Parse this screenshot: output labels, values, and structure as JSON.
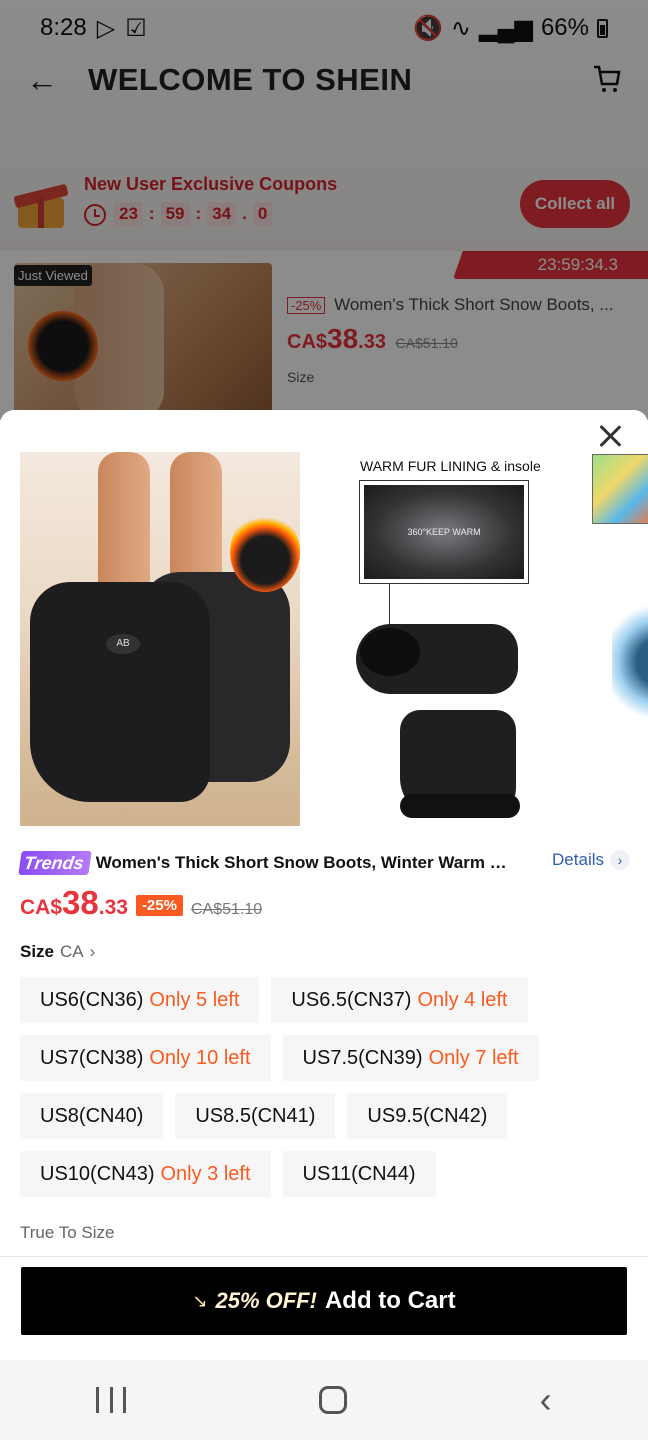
{
  "status_bar": {
    "time": "8:28",
    "battery": "66%"
  },
  "header": {
    "title": "WELCOME TO SHEIN"
  },
  "coupon_banner": {
    "title": "New User Exclusive Coupons",
    "countdown": {
      "hours": "23",
      "minutes": "59",
      "seconds": "34",
      "tenths": "0"
    },
    "collect_label": "Collect all"
  },
  "background_product": {
    "badge": "Just Viewed",
    "timer": "23:59:34.3",
    "discount": "-25%",
    "name": "Women's Thick Short Snow Boots, ...",
    "currency": "CA$",
    "price_int": "38",
    "price_dec": ".33",
    "original_price": "CA$51.10",
    "size_label": "Size"
  },
  "gallery": {
    "boot_logo": "AB",
    "fur_caption": "WARM FUR LINING & insole",
    "keep_warm": "360°KEEP WARM"
  },
  "product": {
    "trend_badge": "Trends",
    "title": "Women's Thick Short Snow Boots, Winter Warm Pl...",
    "details_label": "Details",
    "currency": "CA$",
    "price_int": "38",
    "price_dec": ".33",
    "discount": "-25%",
    "original_price": "CA$51.10"
  },
  "size_section": {
    "label": "Size",
    "unit": "CA",
    "rows": [
      [
        {
          "size": "US6(CN36)",
          "stock": "Only 5 left"
        },
        {
          "size": "US6.5(CN37)",
          "stock": "Only 4 left"
        }
      ],
      [
        {
          "size": "US7(CN38)",
          "stock": "Only 10 left"
        },
        {
          "size": "US7.5(CN39)",
          "stock": "Only 7 left"
        }
      ],
      [
        {
          "size": "US8(CN40)",
          "stock": ""
        },
        {
          "size": "US8.5(CN41)",
          "stock": ""
        },
        {
          "size": "US9.5(CN42)",
          "stock": ""
        }
      ],
      [
        {
          "size": "US10(CN43)",
          "stock": "Only 3 left"
        },
        {
          "size": "US11(CN44)",
          "stock": ""
        }
      ]
    ],
    "fit_note": "True To Size"
  },
  "cta": {
    "promo": "25% OFF!",
    "label": "Add to Cart"
  },
  "colors": {
    "accent_red": "#e8343f",
    "stock_orange": "#fa5a1f",
    "trends_purple": "#8a4cf5",
    "link_blue": "#2f5db5"
  }
}
